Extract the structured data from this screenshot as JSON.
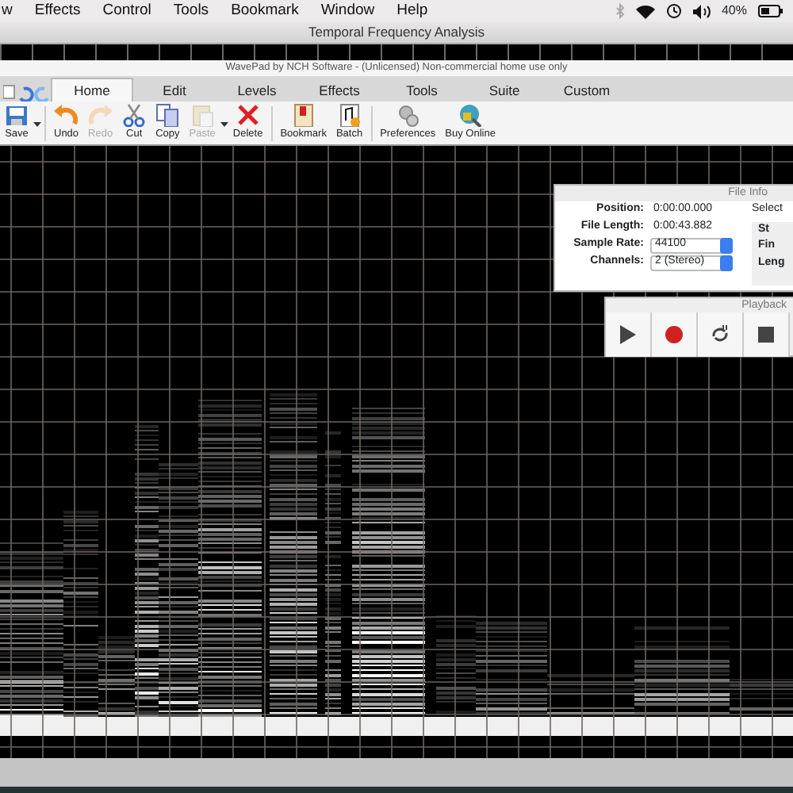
{
  "menu_bar": {
    "items": [
      "w",
      "Effects",
      "Control",
      "Tools",
      "Bookmark",
      "Window",
      "Help"
    ],
    "battery": "40%"
  },
  "window": {
    "title": "Temporal Frequency Analysis"
  },
  "app_title": "WavePad by NCH Software - (Unlicensed) Non-commercial home use only",
  "tabs": [
    {
      "label": "Home",
      "selected": true
    },
    {
      "label": "Edit",
      "selected": false
    },
    {
      "label": "Levels",
      "selected": false
    },
    {
      "label": "Effects",
      "selected": false
    },
    {
      "label": "Tools",
      "selected": false
    },
    {
      "label": "Suite",
      "selected": false
    },
    {
      "label": "Custom",
      "selected": false
    }
  ],
  "toolbar": [
    {
      "label": "Save",
      "kind": "save",
      "disabled": false,
      "dropdown": true
    },
    {
      "label": "Undo",
      "kind": "undo",
      "disabled": false,
      "dropdown": false
    },
    {
      "label": "Redo",
      "kind": "redo",
      "disabled": true,
      "dropdown": false
    },
    {
      "label": "Cut",
      "kind": "cut",
      "disabled": false,
      "dropdown": false
    },
    {
      "label": "Copy",
      "kind": "copy",
      "disabled": false,
      "dropdown": false
    },
    {
      "label": "Paste",
      "kind": "paste",
      "disabled": true,
      "dropdown": true
    },
    {
      "label": "Delete",
      "kind": "delete",
      "disabled": false,
      "dropdown": false
    },
    {
      "label": "Bookmark",
      "kind": "bookmark",
      "disabled": false,
      "dropdown": false
    },
    {
      "label": "Batch",
      "kind": "batch",
      "disabled": false,
      "dropdown": false
    },
    {
      "label": "Preferences",
      "kind": "preferences",
      "disabled": false,
      "dropdown": false
    },
    {
      "label": "Buy Online",
      "kind": "buy",
      "disabled": false,
      "dropdown": false
    }
  ],
  "file_info": {
    "title": "File Info",
    "fields": [
      {
        "label": "Position:",
        "value": "0:00:00.000",
        "kind": "text"
      },
      {
        "label": "File Length:",
        "value": "0:00:43.882",
        "kind": "text"
      },
      {
        "label": "Sample Rate:",
        "value": "44100",
        "kind": "select"
      },
      {
        "label": "Channels:",
        "value": "2 (Stereo)",
        "kind": "select"
      }
    ],
    "selection": {
      "title": "Select",
      "labels": [
        "St",
        "Fin",
        "Leng"
      ]
    }
  },
  "playback": {
    "title": "Playback",
    "buttons": [
      {
        "kind": "play"
      },
      {
        "kind": "record"
      },
      {
        "kind": "loop"
      },
      {
        "kind": "stop"
      }
    ]
  }
}
